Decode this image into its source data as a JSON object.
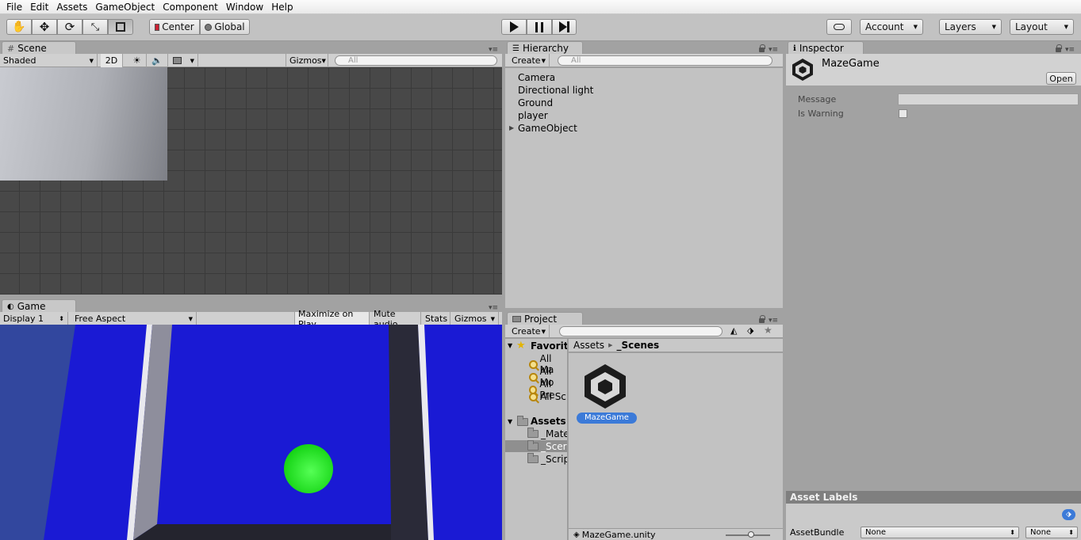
{
  "menu": [
    "File",
    "Edit",
    "Assets",
    "GameObject",
    "Component",
    "Window",
    "Help"
  ],
  "toolbar": {
    "tools": [
      "hand-icon",
      "move-icon",
      "rotate-icon",
      "scale-icon",
      "rect-transform-icon"
    ],
    "pivot": "Center",
    "space": "Global",
    "play": [
      "play-icon",
      "pause-icon",
      "step-icon"
    ],
    "cloud": "cloud-icon",
    "account": "Account",
    "layers": "Layers",
    "layout": "Layout"
  },
  "scene": {
    "tab": "Scene",
    "shading": "Shaded",
    "mode2d": "2D",
    "gizmos": "Gizmos",
    "search_placeholder": "All"
  },
  "game": {
    "tab": "Game",
    "display": "Display 1",
    "aspect": "Free Aspect",
    "maximize": "Maximize on Play",
    "mute": "Mute audio",
    "stats": "Stats",
    "gizmos": "Gizmos"
  },
  "hierarchy": {
    "tab": "Hierarchy",
    "create": "Create",
    "search_placeholder": "All",
    "items": [
      "Camera",
      "Directional light",
      "Ground",
      "player",
      "GameObject"
    ]
  },
  "project": {
    "tab": "Project",
    "create": "Create",
    "favorites_label": "Favorit",
    "favorites": [
      "All Ma",
      "All Mo",
      "All Pre",
      "All Sc"
    ],
    "assets_label": "Assets",
    "folders": [
      "_Mate",
      "_Scer",
      "_Scrip"
    ],
    "breadcrumb": [
      "Assets",
      "_Scenes"
    ],
    "asset_name": "MazeGame",
    "footer_file": "MazeGame.unity"
  },
  "inspector": {
    "tab": "Inspector",
    "title": "MazeGame",
    "open": "Open",
    "message_label": "Message",
    "message_value": "",
    "warning_label": "Is Warning",
    "asset_labels": "Asset Labels",
    "assetbundle_label": "AssetBundle",
    "bundle1": "None",
    "bundle2": "None"
  },
  "colors": {
    "editor_bg": "#c2c2c2",
    "scene_bg": "#484848",
    "game_floor": "#1a1ad4",
    "player_ball": "#1ef01e",
    "selection": "#3b7ad8"
  }
}
